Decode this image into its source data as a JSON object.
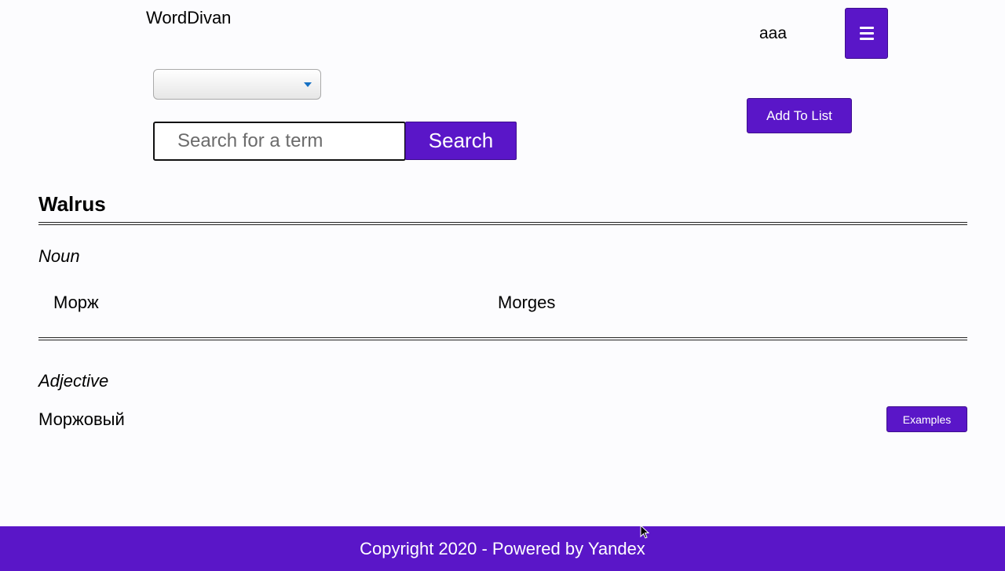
{
  "header": {
    "brand": "WordDivan",
    "username": "aaa",
    "menu_icon": "hamburger-menu-icon"
  },
  "search": {
    "language_select_value": "",
    "placeholder": "Search for a term",
    "button_label": "Search"
  },
  "actions": {
    "add_to_list_label": "Add To List"
  },
  "entry": {
    "word": "Walrus",
    "sections": [
      {
        "part_of_speech": "Noun",
        "translations": [
          "Морж",
          "Morges"
        ]
      },
      {
        "part_of_speech": "Adjective",
        "translations": [
          "Моржовый"
        ],
        "examples_label": "Examples"
      }
    ]
  },
  "footer": {
    "text": "Copyright 2020 - Powered by Yandex"
  },
  "colors": {
    "accent": "#5a16c8",
    "background": "#fcfcfe"
  }
}
